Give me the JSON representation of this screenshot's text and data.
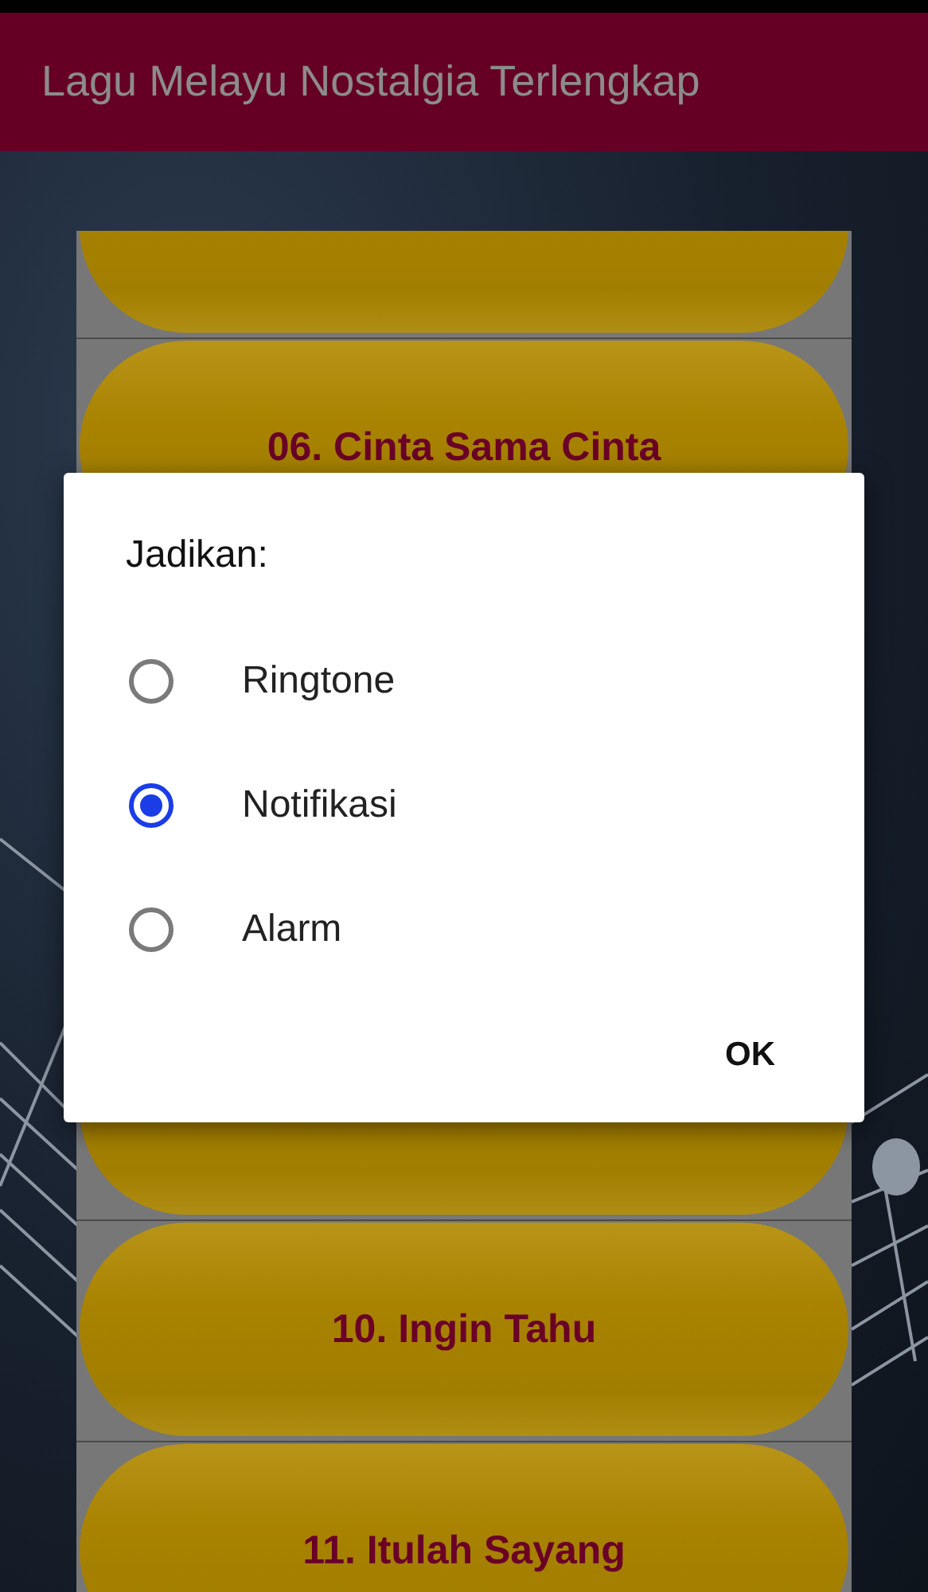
{
  "app_bar": {
    "title": "Lagu Melayu Nostalgia Terlengkap"
  },
  "songs": [
    {
      "kind": "covered"
    },
    {
      "kind": "song",
      "title": "06. Cinta Sama Cinta"
    },
    {
      "kind": "covered"
    },
    {
      "kind": "song",
      "title": "10. Ingin Tahu"
    },
    {
      "kind": "song",
      "title": "11. Itulah Sayang"
    }
  ],
  "dialog": {
    "title": "Jadikan:",
    "options": [
      {
        "label": "Ringtone",
        "selected": false
      },
      {
        "label": "Notifikasi",
        "selected": true
      },
      {
        "label": "Alarm",
        "selected": false
      }
    ],
    "button": "OK"
  }
}
